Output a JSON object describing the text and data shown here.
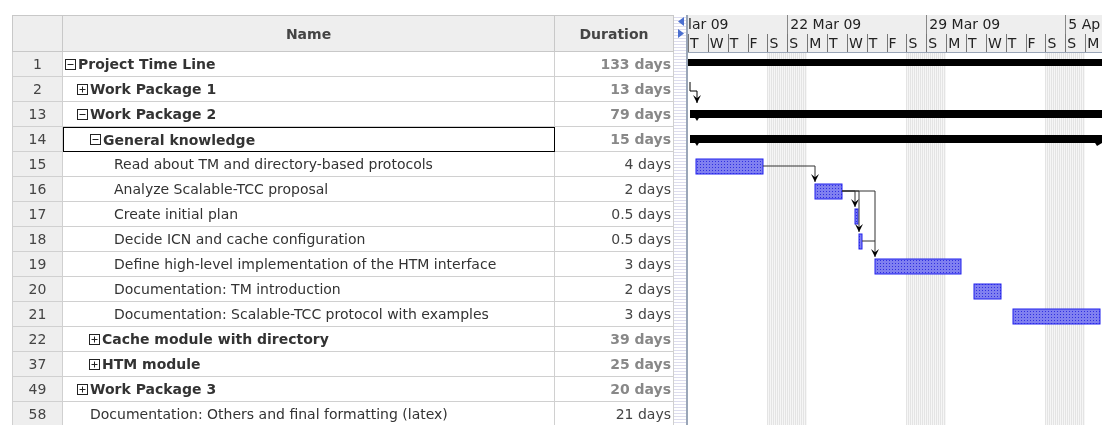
{
  "columns": [
    "Name",
    "Duration"
  ],
  "tasks": [
    {
      "number": "1",
      "name": "Project Time Line",
      "duration": "133 days",
      "kind": "summary",
      "expanded": true,
      "selected": false,
      "children": [
        {
          "number": "2",
          "name": "Work Package 1",
          "duration": "13 days",
          "kind": "summary",
          "expanded": false,
          "selected": false
        },
        {
          "number": "13",
          "name": "Work Package 2",
          "duration": "79 days",
          "kind": "summary",
          "expanded": true,
          "selected": false,
          "children": [
            {
              "number": "14",
              "name": "General knowledge",
              "duration": "15 days",
              "kind": "summary",
              "expanded": true,
              "selected": true,
              "children": [
                {
                  "number": "15",
                  "name": "Read about TM and directory-based protocols",
                  "duration": "4 days",
                  "kind": "task",
                  "selected": false
                },
                {
                  "number": "16",
                  "name": "Analyze Scalable-TCC proposal",
                  "duration": "2 days",
                  "kind": "task",
                  "selected": false
                },
                {
                  "number": "17",
                  "name": "Create initial plan",
                  "duration": "0.5 days",
                  "kind": "task",
                  "selected": false
                },
                {
                  "number": "18",
                  "name": "Decide ICN and cache configuration",
                  "duration": "0.5 days",
                  "kind": "task",
                  "selected": false
                },
                {
                  "number": "19",
                  "name": "Define high-level implementation of the HTM interface",
                  "duration": "3 days",
                  "kind": "task",
                  "selected": false
                },
                {
                  "number": "20",
                  "name": "Documentation: TM introduction",
                  "duration": "2 days",
                  "kind": "task",
                  "selected": false
                },
                {
                  "number": "21",
                  "name": "Documentation: Scalable-TCC protocol with examples",
                  "duration": "3 days",
                  "kind": "task",
                  "selected": false
                }
              ]
            },
            {
              "number": "22",
              "name": "Cache module with directory",
              "duration": "39 days",
              "kind": "summary",
              "expanded": false,
              "selected": false
            },
            {
              "number": "37",
              "name": "HTM module",
              "duration": "25 days",
              "kind": "summary",
              "expanded": false,
              "selected": false
            }
          ]
        },
        {
          "number": "49",
          "name": "Work Package 3",
          "duration": "20 days",
          "kind": "summary",
          "expanded": false,
          "selected": false
        },
        {
          "number": "58",
          "name": "Documentation: Others and final formatting (latex)",
          "duration": "21 days",
          "kind": "task",
          "selected": false
        }
      ]
    }
  ],
  "timeline": {
    "weeks": [
      {
        "label": "lar 09"
      },
      {
        "label": "22 Mar 09"
      },
      {
        "label": "29 Mar 09"
      },
      {
        "label": "5 Ap"
      }
    ],
    "days": [
      {
        "letter": "T",
        "weekend": false
      },
      {
        "letter": "W",
        "weekend": false
      },
      {
        "letter": "T",
        "weekend": false
      },
      {
        "letter": "F",
        "weekend": false
      },
      {
        "letter": "S",
        "weekend": true
      },
      {
        "letter": "S",
        "weekend": true
      },
      {
        "letter": "M",
        "weekend": false
      },
      {
        "letter": "T",
        "weekend": false
      },
      {
        "letter": "W",
        "weekend": false
      },
      {
        "letter": "T",
        "weekend": false
      },
      {
        "letter": "F",
        "weekend": false
      },
      {
        "letter": "S",
        "weekend": true
      },
      {
        "letter": "S",
        "weekend": true
      },
      {
        "letter": "M",
        "weekend": false
      },
      {
        "letter": "T",
        "weekend": false
      },
      {
        "letter": "W",
        "weekend": false
      },
      {
        "letter": "T",
        "weekend": false
      },
      {
        "letter": "F",
        "weekend": false
      },
      {
        "letter": "S",
        "weekend": true
      },
      {
        "letter": "S",
        "weekend": true
      },
      {
        "letter": "M",
        "weekend": false
      }
    ]
  }
}
